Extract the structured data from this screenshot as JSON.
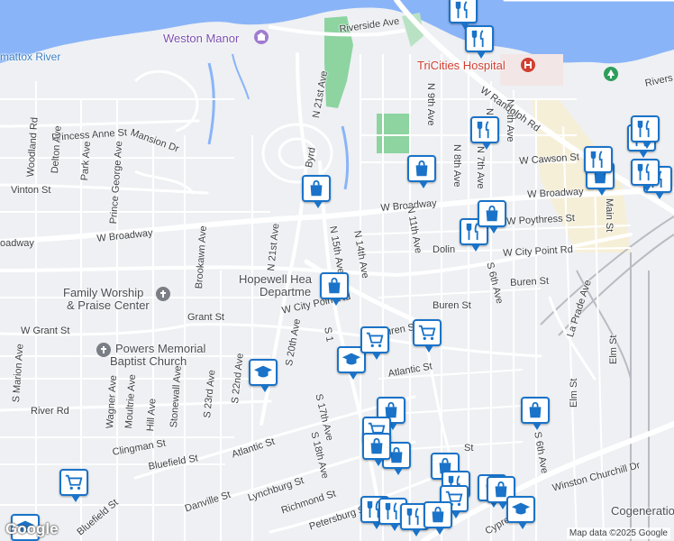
{
  "map": {
    "attribution": "Map data ©2025 Google",
    "logo_text": "Google",
    "colors": {
      "water": "#8ab4f8",
      "land": "#eef0f3",
      "road": "#ffffff",
      "park": "#8dd4a0",
      "rail": "#b8bcc2",
      "pin": "#1a73c8",
      "hospital": "#d23f31",
      "church": "#7b4fb0"
    }
  },
  "pois": {
    "weston_manor": "Weston Manor",
    "tricities_hospital": "TriCities Hospital",
    "family_worship": "Family Worship",
    "praise_center": "& Praise Center",
    "powers_memorial": "Powers Memorial",
    "baptist_church": "Baptist Church",
    "hopewell_health_1": "Hopewell Hea",
    "hopewell_health_2": "Departme",
    "cogeneration": "Cogeneratio",
    "river": "mattox River"
  },
  "streets": {
    "riverside_ave": "Riverside Ave",
    "riverside_ave_2": "Rivers",
    "n21st_ave_north": "N 21st Ave",
    "byrd": "Byrd",
    "princess_anne": "Princess Anne St",
    "mansion_dr": "Mansion Dr",
    "woodland_rd": "Woodland Rd",
    "delton_ave": "Delton Ave",
    "park_ave": "Park Ave",
    "prince_george_ave": "Prince George Ave",
    "vinton_st": "Vinton St",
    "w_broadway_left": "W Broadway",
    "w_broadway_mid": "W Broadway",
    "w_broadway_right": "W Broadway",
    "broadway_edge": "oadway",
    "brookawn_ave": "Brookawn Ave",
    "n21st_ave": "N 21st Ave",
    "n15th_ave": "N 15th Ave",
    "n14th_ave": "N 14th Ave",
    "n11th_ave": "N 11th Ave",
    "n9th_ave": "N 9th Ave",
    "n8th_ave": "N 8th Ave",
    "n7th_ave": "N 7th Ave",
    "n6th": "N 6th",
    "n5th_ave": "N 5th Ave",
    "w_randolph_rd": "W Randolph Rd",
    "w_cawson_st": "W Cawson St",
    "w_poythress_st": "W Poythress St",
    "d_st": "D",
    "dolin": "Dolin",
    "w_city_point_rd_right": "W City Point Rd",
    "w_city_point_rd_mid": "W City Point Rd",
    "main_st": "Main St",
    "buren_st_right": "Buren St",
    "buren_st_mid": "Buren St",
    "buren_st_small": "Buren St",
    "s6th_ave": "S 6th Ave",
    "la_prade_ave": "La Prade Ave",
    "elm_st": "Elm St",
    "elm_st_lower": "Elm St",
    "w_grant_st": "W Grant St",
    "grant_st": "Grant St",
    "s_marion_ave": "S Marion Ave",
    "wagner_ave": "Wagner Ave",
    "moultrie_ave": "Moultrie Ave",
    "hill_ave": "Hill Ave",
    "stonewall_ave": "Stonewall Ave",
    "s22nd_ave": "S 22nd Ave",
    "s23rd_ave": "S 23rd Ave",
    "s20th_ave": "S 20th Ave",
    "s21_ave": "S 2",
    "river_rd": "River Rd",
    "atlantic_st_left": "Atlantic St",
    "atlantic_st_right": "Atlantic St",
    "clingman_st": "Clingman St",
    "bluefield_st": "Bluefield St",
    "bluefield_st_lower": "Bluefield St",
    "s17th_ave": "S 17th Ave",
    "s18th_ave": "S 18th Ave",
    "s1": "S 1",
    "lynchburg_st": "Lynchburg St",
    "richmond_st": "Richmond St",
    "danville_st": "Danville St",
    "petersburg_st": "Petersburg St",
    "winston_churchill_dr": "Winston Churchill Dr",
    "cypr": "Cypre",
    "s6th_ave_lower": "S 6th Ave",
    "e_dr": "Dr",
    "ave_small": "Ave",
    "st_small": "St",
    "ne_dr": "Dr",
    "oantic_st": "antic St",
    "ve": "ve",
    "nte": "e",
    "st_vertical": "St"
  },
  "pins": [
    {
      "id": "p1",
      "icon": "restaurant-icon"
    },
    {
      "id": "p2",
      "icon": "restaurant-icon"
    },
    {
      "id": "p3",
      "icon": "restaurant-icon"
    },
    {
      "id": "p4",
      "icon": "restaurant-icon"
    },
    {
      "id": "p5",
      "icon": "restaurant-icon"
    },
    {
      "id": "p6",
      "icon": "restaurant-icon"
    },
    {
      "id": "p7",
      "icon": "shopping-bag-icon"
    },
    {
      "id": "p8",
      "icon": "shopping-bag-icon"
    },
    {
      "id": "p9",
      "icon": "shopping-bag-icon"
    },
    {
      "id": "p10",
      "icon": "shopping-bag-icon"
    },
    {
      "id": "p11",
      "icon": "shopping-bag-icon"
    },
    {
      "id": "p12",
      "icon": "grocery-cart-icon"
    },
    {
      "id": "p13",
      "icon": "grocery-cart-icon"
    },
    {
      "id": "p14",
      "icon": "school-icon"
    },
    {
      "id": "p15",
      "icon": "school-icon"
    }
  ]
}
